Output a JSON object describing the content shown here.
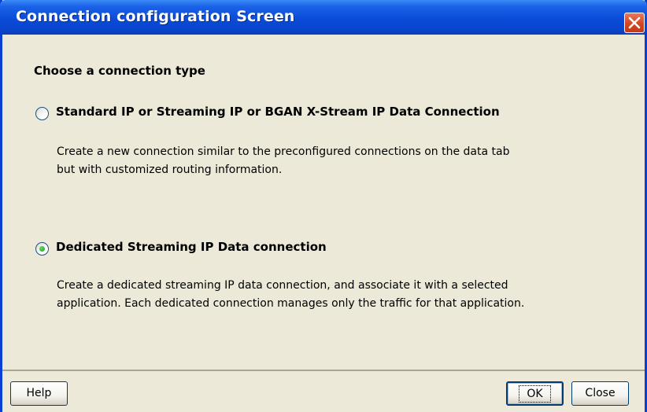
{
  "window": {
    "title": "Connection configuration Screen",
    "close_icon": "close-x-icon"
  },
  "content": {
    "heading": "Choose a connection type",
    "options": [
      {
        "label": "Standard IP or Streaming IP or BGAN X-Stream IP Data Connection",
        "selected": false,
        "description_line1": "Create a new connection similar to the preconfigured connections on the data tab",
        "description_line2": "but with customized routing information."
      },
      {
        "label": "Dedicated Streaming IP Data connection",
        "selected": true,
        "description_line1": "Create a dedicated streaming IP data connection, and associate it with a selected",
        "description_line2": "application. Each dedicated connection manages only the traffic for that application."
      }
    ]
  },
  "buttons": {
    "help": "Help",
    "ok": "OK",
    "close": "Close"
  },
  "colors": {
    "titlebar": "#0a45cc",
    "dialog_background": "#ece9d8",
    "close_button": "#d4461e",
    "radio_selected_dot": "#21a121"
  }
}
